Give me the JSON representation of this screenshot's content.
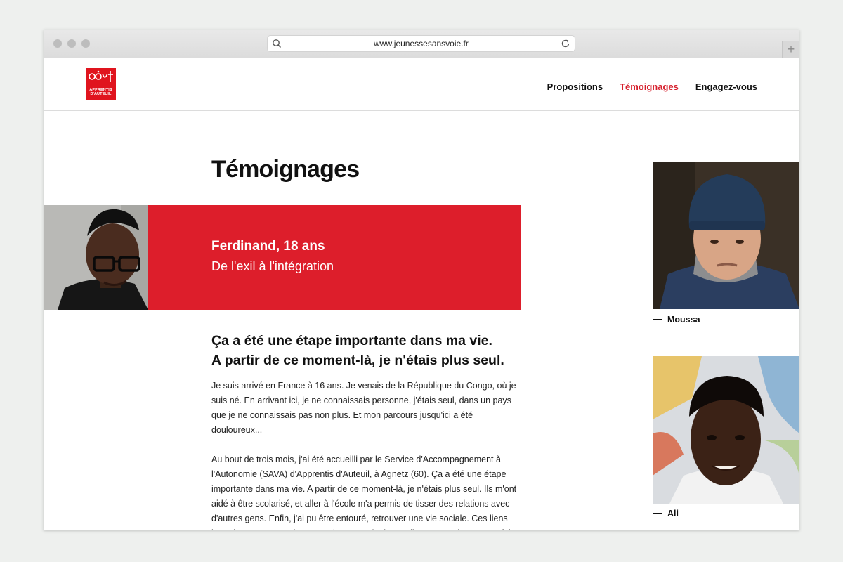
{
  "browser": {
    "url": "www.jeunessesansvoie.fr",
    "new_tab_symbol": "+"
  },
  "header": {
    "logo": {
      "line1": "APPRENTIS",
      "line2": "D'AUTEUIL"
    },
    "nav": [
      {
        "label": "Propositions",
        "active": false
      },
      {
        "label": "Témoignages",
        "active": true
      },
      {
        "label": "Engagez-vous",
        "active": false
      }
    ]
  },
  "main": {
    "title": "Témoignages",
    "featured": {
      "name": "Ferdinand, 18 ans",
      "subtitle": "De l'exil à l'intégration"
    },
    "quote_line1": "Ça a été une étape importante dans ma vie.",
    "quote_line2": "A partir de ce moment-là, je n'étais plus seul.",
    "paragraphs": [
      "Je suis arrivé en France à 16 ans. Je venais de la République du Congo, où je suis né. En arrivant ici, je ne connaissais personne, j'étais seul, dans un pays que je ne connaissais pas non plus. Et mon parcours jusqu'ici a été douloureux...",
      "Au bout de trois mois, j'ai été accueilli par le Service d'Accompagnement à l'Autonomie (SAVA) d'Apprentis d'Auteuil, à Agnetz (60). Ça a été une étape importante dans ma vie. A partir de ce moment-là, je n'étais plus seul. Ils m'ont aidé à être scolarisé, et aller à l'école m'a permis de tisser des relations avec d'autres gens. Enfin, j'ai pu être entouré, retrouver une vie sociale. Ces liens humains me manquaient. Et puis Apprentis d'Auteuil m'a montré comment faire"
    ]
  },
  "sidebar": {
    "people": [
      {
        "name": "Moussa"
      },
      {
        "name": "Ali"
      }
    ]
  },
  "colors": {
    "brand_red": "#dd1e2b",
    "active_nav": "#d61f2c"
  }
}
